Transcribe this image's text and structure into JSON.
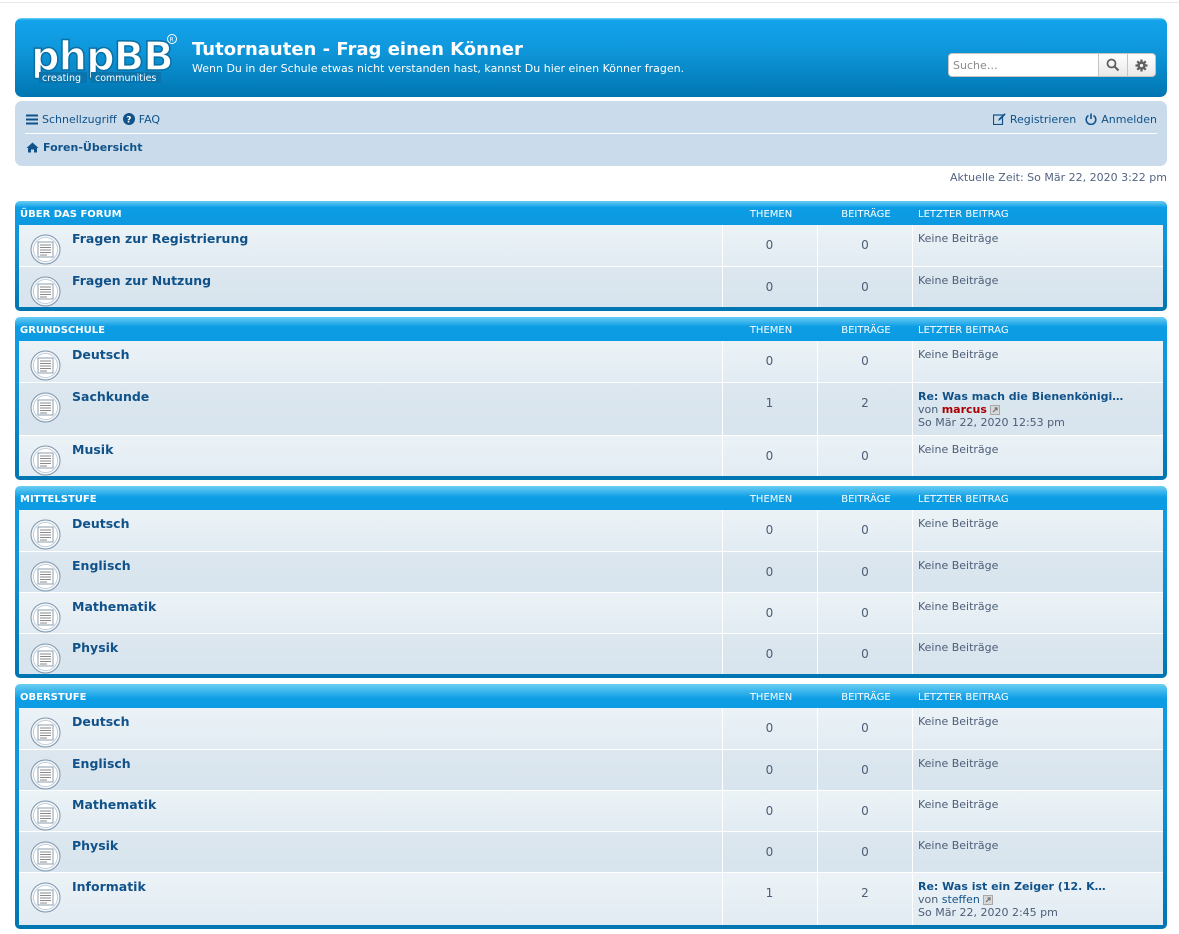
{
  "header": {
    "logo_text": "phpBB",
    "logo_tagline_1": "creating",
    "logo_tagline_2": "communities",
    "title": "Tutornauten - Frag einen Könner",
    "description": "Wenn Du in der Schule etwas nicht verstanden hast, kannst Du hier einen Könner fragen.",
    "search_placeholder": "Suche…"
  },
  "navbar": {
    "quicklinks": "Schnellzugriff",
    "faq": "FAQ",
    "register": "Registrieren",
    "login": "Anmelden",
    "breadcrumb": "Foren-Übersicht"
  },
  "current_time": "Aktuelle Zeit: So Mär 22, 2020 3:22 pm",
  "columns": {
    "topics": "THEMEN",
    "posts": "BEITRÄGE",
    "last": "LETZTER BEITRAG"
  },
  "categories": [
    {
      "name": "ÜBER DAS FORUM",
      "forums": [
        {
          "name": "Fragen zur Registrierung",
          "topics": "0",
          "posts": "0",
          "last": "Keine Beiträge"
        },
        {
          "name": "Fragen zur Nutzung",
          "topics": "0",
          "posts": "0",
          "last": "Keine Beiträge"
        }
      ]
    },
    {
      "name": "GRUNDSCHULE",
      "forums": [
        {
          "name": "Deutsch",
          "topics": "0",
          "posts": "0",
          "last": "Keine Beiträge"
        },
        {
          "name": "Sachkunde",
          "topics": "1",
          "posts": "2",
          "last_title": "Re: Was mach die Bienenkönigi…",
          "last_by": "von",
          "last_user": "marcus",
          "last_date": "So Mär 22, 2020 12:53 pm"
        },
        {
          "name": "Musik",
          "topics": "0",
          "posts": "0",
          "last": "Keine Beiträge"
        }
      ]
    },
    {
      "name": "MITTELSTUFE",
      "forums": [
        {
          "name": "Deutsch",
          "topics": "0",
          "posts": "0",
          "last": "Keine Beiträge"
        },
        {
          "name": "Englisch",
          "topics": "0",
          "posts": "0",
          "last": "Keine Beiträge"
        },
        {
          "name": "Mathematik",
          "topics": "0",
          "posts": "0",
          "last": "Keine Beiträge"
        },
        {
          "name": "Physik",
          "topics": "0",
          "posts": "0",
          "last": "Keine Beiträge"
        }
      ]
    },
    {
      "name": "OBERSTUFE",
      "forums": [
        {
          "name": "Deutsch",
          "topics": "0",
          "posts": "0",
          "last": "Keine Beiträge"
        },
        {
          "name": "Englisch",
          "topics": "0",
          "posts": "0",
          "last": "Keine Beiträge"
        },
        {
          "name": "Mathematik",
          "topics": "0",
          "posts": "0",
          "last": "Keine Beiträge"
        },
        {
          "name": "Physik",
          "topics": "0",
          "posts": "0",
          "last": "Keine Beiträge"
        },
        {
          "name": "Informatik",
          "topics": "1",
          "posts": "2",
          "last_title": "Re: Was ist ein Zeiger (12. K…",
          "last_by": "von",
          "last_user": "steffen",
          "last_date": "So Mär 22, 2020 2:45 pm"
        }
      ]
    }
  ],
  "colors": {
    "header_blue": "#0f97db",
    "nav_bg": "#cadceb",
    "link": "#105289",
    "user_red": "#aa0000"
  }
}
